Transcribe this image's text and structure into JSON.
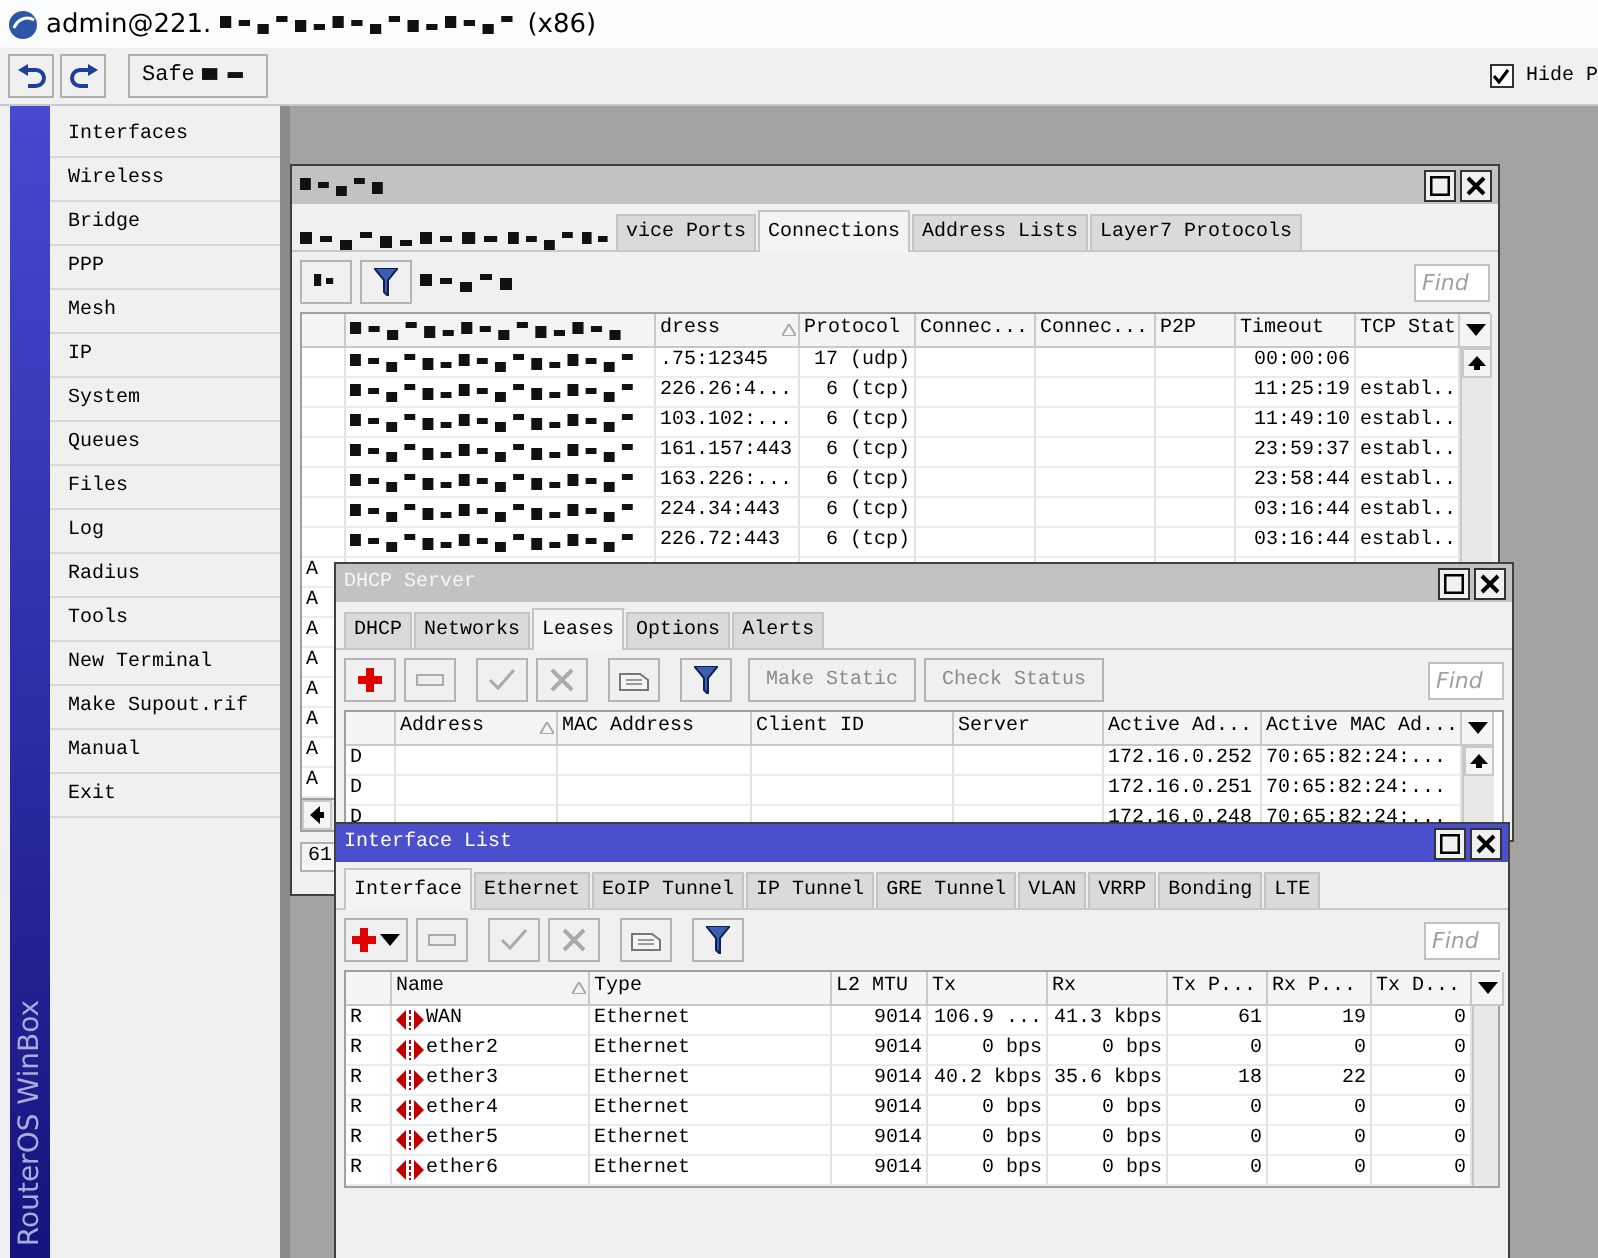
{
  "window": {
    "title_start": "admin@221.",
    "title_end": "(x86)"
  },
  "toolbar": {
    "safe_mode": "Safe",
    "hide": {
      "label": "Hide P",
      "checked": true
    }
  },
  "sidebar": {
    "brand": "RouterOS WinBox",
    "items": [
      {
        "label": "Interfaces"
      },
      {
        "label": "Wireless"
      },
      {
        "label": "Bridge"
      },
      {
        "label": "PPP"
      },
      {
        "label": "Mesh"
      },
      {
        "label": "IP"
      },
      {
        "label": "System"
      },
      {
        "label": "Queues"
      },
      {
        "label": "Files"
      },
      {
        "label": "Log"
      },
      {
        "label": "Radius"
      },
      {
        "label": "Tools"
      },
      {
        "label": "New Terminal"
      },
      {
        "label": "Make Supout.rif"
      },
      {
        "label": "Manual"
      },
      {
        "label": "Exit"
      }
    ]
  },
  "connections_window": {
    "active": false,
    "tabs": [
      {
        "label": "vice Ports",
        "selected": false
      },
      {
        "label": "Connections",
        "selected": true
      },
      {
        "label": "Address Lists",
        "selected": false
      },
      {
        "label": "Layer7 Protocols",
        "selected": false
      }
    ],
    "find_placeholder": "Find",
    "columns": [
      {
        "label": "dress"
      },
      {
        "label": "Protocol"
      },
      {
        "label": "Connec..."
      },
      {
        "label": "Connec..."
      },
      {
        "label": "P2P"
      },
      {
        "label": "Timeout"
      },
      {
        "label": "TCP Stat"
      }
    ],
    "rows": [
      {
        "dst_address": ".75:12345",
        "protocol": "17 (udp)",
        "timeout": "00:00:06"
      },
      {
        "dst_address": "226.26:4...",
        "protocol": "6 (tcp)",
        "timeout": "11:25:19",
        "tcp_state": "establ.."
      },
      {
        "dst_address": "103.102:...",
        "protocol": "6 (tcp)",
        "timeout": "11:49:10",
        "tcp_state": "establ.."
      },
      {
        "dst_address": "161.157:443",
        "protocol": "6 (tcp)",
        "timeout": "23:59:37",
        "tcp_state": "establ.."
      },
      {
        "dst_address": "163.226:...",
        "protocol": "6 (tcp)",
        "timeout": "23:58:44",
        "tcp_state": "establ.."
      },
      {
        "dst_address": "224.34:443",
        "protocol": "6 (tcp)",
        "timeout": "03:16:44",
        "tcp_state": "establ.."
      },
      {
        "dst_address": "226.72:443",
        "protocol": "6 (tcp)",
        "timeout": "03:16:44",
        "tcp_state": "establ.."
      },
      {
        "flag": "A"
      },
      {
        "flag": "A"
      },
      {
        "flag": "A"
      },
      {
        "flag": "A"
      },
      {
        "flag": "A"
      },
      {
        "flag": "A"
      },
      {
        "flag": "A"
      },
      {
        "flag": "A"
      }
    ],
    "status": "61"
  },
  "dhcp_window": {
    "title": "DHCP Server",
    "active": false,
    "tabs": [
      {
        "label": "DHCP",
        "selected": false
      },
      {
        "label": "Networks",
        "selected": false
      },
      {
        "label": "Leases",
        "selected": true
      },
      {
        "label": "Options",
        "selected": false
      },
      {
        "label": "Alerts",
        "selected": false
      }
    ],
    "buttons": [
      {
        "label": "Make Static",
        "disabled": true
      },
      {
        "label": "Check Status",
        "disabled": true
      }
    ],
    "find_placeholder": "Find",
    "columns": [
      {
        "label": "Address"
      },
      {
        "label": "MAC Address"
      },
      {
        "label": "Client ID"
      },
      {
        "label": "Server"
      },
      {
        "label": "Active Ad..."
      },
      {
        "label": "Active MAC Ad..."
      }
    ],
    "rows": [
      {
        "flag": "D",
        "active_address": "172.16.0.252",
        "active_mac": "70:65:82:24:..."
      },
      {
        "flag": "D",
        "active_address": "172.16.0.251",
        "active_mac": "70:65:82:24:..."
      },
      {
        "flag": "D",
        "active_address": "172.16.0.248",
        "active_mac": "70:65:82:24:..."
      }
    ]
  },
  "interface_window": {
    "title": "Interface List",
    "active": true,
    "tabs": [
      {
        "label": "Interface",
        "selected": true
      },
      {
        "label": "Ethernet",
        "selected": false
      },
      {
        "label": "EoIP Tunnel",
        "selected": false
      },
      {
        "label": "IP Tunnel",
        "selected": false
      },
      {
        "label": "GRE Tunnel",
        "selected": false
      },
      {
        "label": "VLAN",
        "selected": false
      },
      {
        "label": "VRRP",
        "selected": false
      },
      {
        "label": "Bonding",
        "selected": false
      },
      {
        "label": "LTE",
        "selected": false
      }
    ],
    "find_placeholder": "Find",
    "columns": [
      {
        "label": "Name"
      },
      {
        "label": "Type"
      },
      {
        "label": "L2 MTU"
      },
      {
        "label": "Tx"
      },
      {
        "label": "Rx"
      },
      {
        "label": "Tx P..."
      },
      {
        "label": "Rx P..."
      },
      {
        "label": "Tx D..."
      }
    ],
    "rows": [
      {
        "flag": "R",
        "name": "WAN",
        "type": "Ethernet",
        "l2_mtu": "9014",
        "tx": "106.9 ...",
        "rx": "41.3 kbps",
        "tx_packets": "61",
        "rx_packets": "19",
        "tx_drops": "0"
      },
      {
        "flag": "R",
        "name": "ether2",
        "type": "Ethernet",
        "l2_mtu": "9014",
        "tx": "0 bps",
        "rx": "0 bps",
        "tx_packets": "0",
        "rx_packets": "0",
        "tx_drops": "0"
      },
      {
        "flag": "R",
        "name": "ether3",
        "type": "Ethernet",
        "l2_mtu": "9014",
        "tx": "40.2 kbps",
        "rx": "35.6 kbps",
        "tx_packets": "18",
        "rx_packets": "22",
        "tx_drops": "0"
      },
      {
        "flag": "R",
        "name": "ether4",
        "type": "Ethernet",
        "l2_mtu": "9014",
        "tx": "0 bps",
        "rx": "0 bps",
        "tx_packets": "0",
        "rx_packets": "0",
        "tx_drops": "0"
      },
      {
        "flag": "R",
        "name": "ether5",
        "type": "Ethernet",
        "l2_mtu": "9014",
        "tx": "0 bps",
        "rx": "0 bps",
        "tx_packets": "0",
        "rx_packets": "0",
        "tx_drops": "0"
      },
      {
        "flag": "R",
        "name": "ether6",
        "type": "Ethernet",
        "l2_mtu": "9014",
        "tx": "0 bps",
        "rx": "0 bps",
        "tx_packets": "0",
        "rx_packets": "0",
        "tx_drops": "0"
      }
    ]
  }
}
